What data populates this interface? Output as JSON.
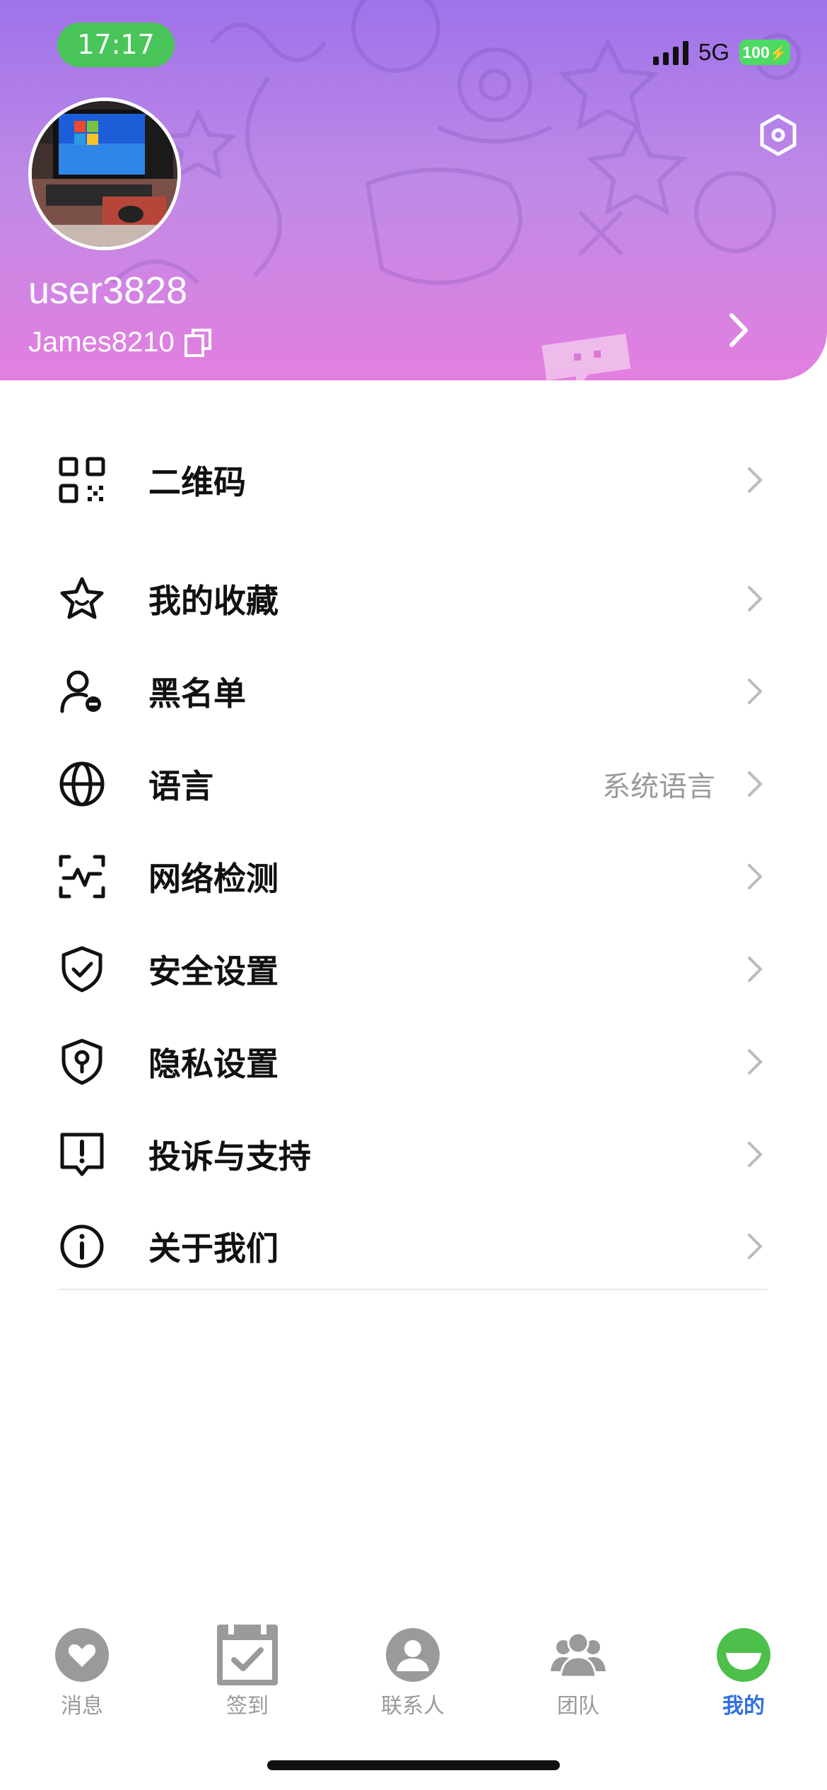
{
  "status_bar": {
    "time": "17:17",
    "network": "5G",
    "battery": "100"
  },
  "profile": {
    "username": "user3828",
    "account_id": "James8210"
  },
  "menu": {
    "group1": [
      {
        "id": "qrcode",
        "label": "二维码",
        "icon": "qr-code-icon"
      }
    ],
    "group2": [
      {
        "id": "favorites",
        "label": "我的收藏",
        "icon": "star-icon"
      },
      {
        "id": "blacklist",
        "label": "黑名单",
        "icon": "user-block-icon"
      },
      {
        "id": "language",
        "label": "语言",
        "value": "系统语言",
        "icon": "globe-icon"
      },
      {
        "id": "network",
        "label": "网络检测",
        "icon": "network-check-icon"
      },
      {
        "id": "security",
        "label": "安全设置",
        "icon": "shield-check-icon"
      },
      {
        "id": "privacy",
        "label": "隐私设置",
        "icon": "privacy-shield-icon"
      },
      {
        "id": "complaint",
        "label": "投诉与支持",
        "icon": "report-icon"
      },
      {
        "id": "about",
        "label": "关于我们",
        "icon": "info-icon"
      }
    ]
  },
  "tabbar": [
    {
      "label": "消息",
      "icon": "heart-chat-icon",
      "active": false
    },
    {
      "label": "签到",
      "icon": "calendar-check-icon",
      "active": false
    },
    {
      "label": "联系人",
      "icon": "person-icon",
      "active": false
    },
    {
      "label": "团队",
      "icon": "group-icon",
      "active": false
    },
    {
      "label": "我的",
      "icon": "smile-icon",
      "active": true
    }
  ],
  "colors": {
    "header_gradient": [
      "#9f72ea",
      "#e37fe0"
    ],
    "status_time_bg": "#49c55a",
    "battery_bg": "#4cd964",
    "active_tab": "#2f6fe0",
    "active_tab_icon": "#4cc04a",
    "inactive_tab": "#9a9a9a"
  }
}
